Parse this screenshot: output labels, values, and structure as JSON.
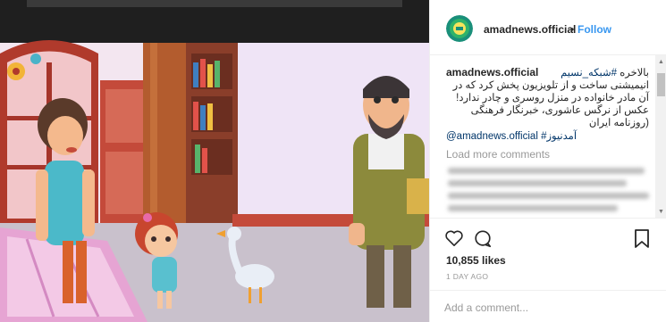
{
  "post": {
    "username": "amadnews.official",
    "separator": "•",
    "follow_label": "Follow"
  },
  "caption": {
    "username": "amadnews.official",
    "line1_text": "بالاخره ",
    "line1_tag": "#شبکه_نسیم",
    "line2": "انیمیشنی ساخت و از تلویزیون پخش کرد که در",
    "line3": "آن مادر خانواده در منزل روسری و چادر ندارد!",
    "line4": "عکس از نرگس عاشوری، خبرنگار فرهنگی",
    "line5": "(روزنامه ایران",
    "tags": "@amadnews.official #آمدنیوز"
  },
  "comments": {
    "load_more": "Load more comments"
  },
  "footer": {
    "likes": "10,855 likes",
    "date": "1 DAY AGO",
    "add_comment_placeholder": "Add a comment..."
  },
  "colors": {
    "link": "#3897f0",
    "hashtag": "#003569",
    "muted": "#999999"
  },
  "icons": [
    "heart-icon",
    "comment-icon",
    "bookmark-icon",
    "avatar-logo-icon",
    "scroll-up-icon",
    "scroll-down-icon"
  ]
}
